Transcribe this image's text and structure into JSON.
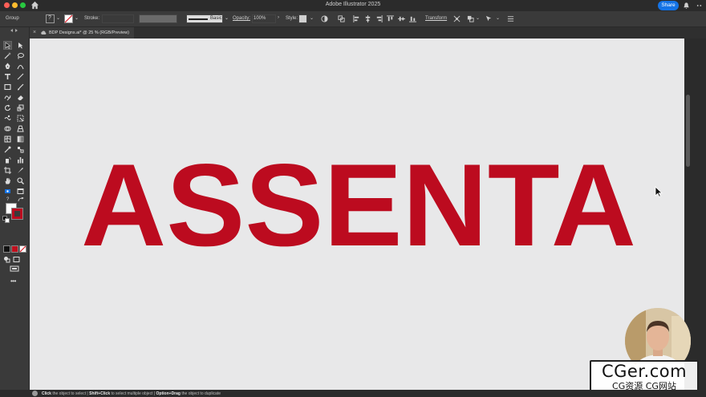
{
  "window": {
    "title": "Adobe Illustrator 2025",
    "share_label": "Share"
  },
  "control_bar": {
    "selection_label": "Group",
    "stroke_label": "Stroke:",
    "brush_label": "Basic",
    "opacity_label": "Opacity:",
    "opacity_value": "100%",
    "style_label": "Style:",
    "transform_label": "Transform"
  },
  "document_tab": {
    "label": "BDP Designs.ai* @ 25 % (RGB/Preview)"
  },
  "artwork": {
    "logo_text": "ASSENTA",
    "logo_color": "#bc0b1f"
  },
  "status_bar": {
    "hint_1_key": "Click",
    "hint_1_text": " the object to select  |  ",
    "hint_2_key": "Shift+Click",
    "hint_2_text": " to select multiple object  |  ",
    "hint_3_key": "Option+Drag",
    "hint_3_text": " the object to duplicate"
  },
  "watermark": {
    "main": "CGer.com",
    "sub": "CG资源 CG网站"
  },
  "colors": {
    "accent": "#1473e6",
    "artboard": "#e8e8e9",
    "fill_swatch": "#ffffff",
    "stroke_swatch": "#bc0b1f"
  }
}
